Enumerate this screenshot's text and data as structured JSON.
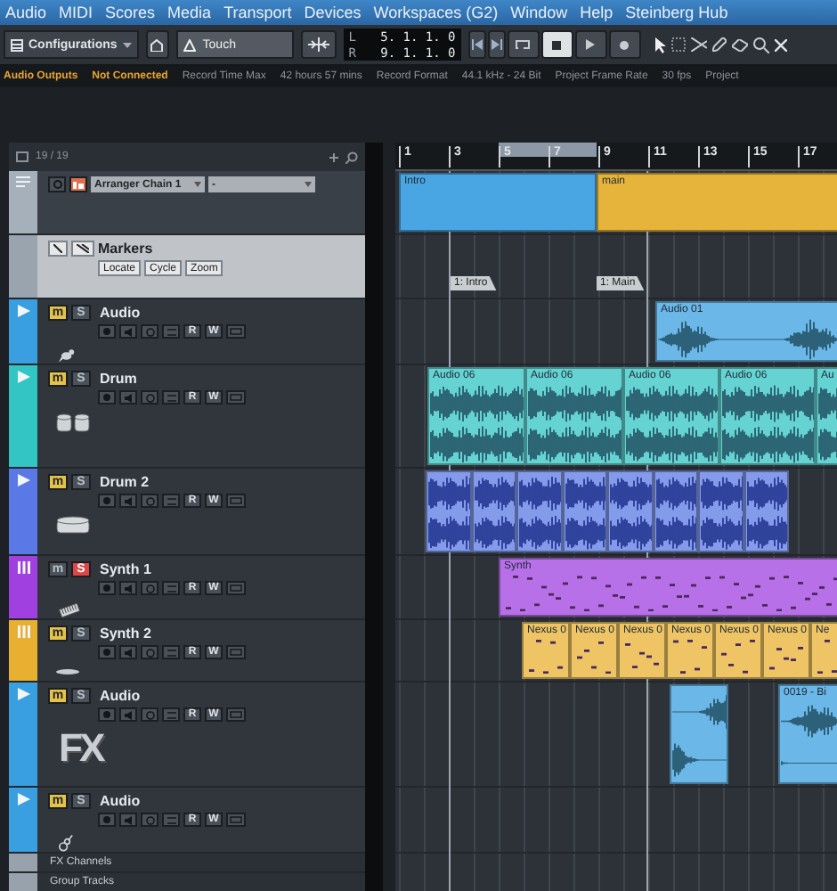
{
  "menu": [
    "Audio",
    "MIDI",
    "Scores",
    "Media",
    "Transport",
    "Devices",
    "Workspaces (G2)",
    "Window",
    "Help",
    "Steinberg Hub"
  ],
  "toolbar": {
    "configurations": "Configurations",
    "automation_mode": "Touch",
    "left_label": "L",
    "left_locator": "5. 1. 1. 0",
    "right_label": "R",
    "right_locator": "9. 1. 1. 0"
  },
  "status": [
    {
      "text": "Audio Outputs",
      "warning": true
    },
    {
      "text": "Not Connected",
      "warning": true
    },
    {
      "text": "Record Time Max",
      "warning": false
    },
    {
      "text": "42 hours 57 mins",
      "warning": false
    },
    {
      "text": "Record Format",
      "warning": false
    },
    {
      "text": "44.1 kHz - 24 Bit",
      "warning": false
    },
    {
      "text": "Project Frame Rate",
      "warning": false
    },
    {
      "text": "30 fps",
      "warning": false
    },
    {
      "text": "Project",
      "warning": false
    }
  ],
  "track_list": {
    "count": "19 / 19"
  },
  "ruler": [
    "1",
    "3",
    "5",
    "7",
    "9",
    "11",
    "13",
    "15",
    "17"
  ],
  "arranger_track": {
    "chain": "Arranger Chain 1",
    "mode": "-",
    "events": [
      {
        "label": "Intro"
      },
      {
        "label": "main"
      }
    ]
  },
  "marker_track": {
    "name": "Markers",
    "buttons": [
      "Locate",
      "Cycle",
      "Zoom"
    ],
    "markers": [
      {
        "label": "1: Intro"
      },
      {
        "label": "1: Main"
      }
    ]
  },
  "tracks": [
    {
      "kind": "audio",
      "name": "Audio",
      "color": "#3a9fe0",
      "mute": true,
      "solo": false,
      "mute_label": "m",
      "solo_label": "S",
      "read": "R",
      "write": "W",
      "clips": [
        {
          "label": "Audio 01"
        }
      ]
    },
    {
      "kind": "audio",
      "name": "Drum",
      "color": "#33c4c4",
      "mute": true,
      "solo": false,
      "mute_label": "m",
      "solo_label": "S",
      "read": "R",
      "write": "W",
      "clips": [
        {
          "label": "Audio 06"
        },
        {
          "label": "Audio 06"
        },
        {
          "label": "Audio 06"
        },
        {
          "label": "Audio 06"
        },
        {
          "label": "Au"
        }
      ]
    },
    {
      "kind": "audio",
      "name": "Drum 2",
      "color": "#5b79e6",
      "mute": true,
      "solo": false,
      "mute_label": "m",
      "solo_label": "S",
      "read": "R",
      "write": "W"
    },
    {
      "kind": "instrument",
      "name": "Synth 1",
      "color": "#a040e0",
      "mute": false,
      "solo": true,
      "mute_label": "m",
      "solo_label": "S",
      "read": "R",
      "write": "W",
      "clips": [
        {
          "label": "Synth"
        }
      ]
    },
    {
      "kind": "instrument",
      "name": "Synth 2",
      "color": "#e8b030",
      "mute": true,
      "solo": false,
      "mute_label": "m",
      "solo_label": "S",
      "read": "R",
      "write": "W",
      "clips": [
        {
          "label": "Nexus 0"
        },
        {
          "label": "Nexus 0"
        },
        {
          "label": "Nexus 0"
        },
        {
          "label": "Nexus 0"
        },
        {
          "label": "Nexus 0"
        },
        {
          "label": "Nexus 0"
        },
        {
          "label": "Ne"
        }
      ]
    },
    {
      "kind": "audio",
      "name": "Audio",
      "color": "#3a9fe0",
      "mute": true,
      "solo": false,
      "mute_label": "m",
      "solo_label": "S",
      "read": "R",
      "write": "W",
      "logo": "FX",
      "clips": [
        {
          "label": "0019 - Bi"
        }
      ]
    },
    {
      "kind": "audio",
      "name": "Audio",
      "color": "#3a9fe0",
      "mute": true,
      "solo": false,
      "mute_label": "m",
      "solo_label": "S",
      "read": "R",
      "write": "W"
    }
  ],
  "folders": [
    "FX Channels",
    "Group Tracks"
  ]
}
